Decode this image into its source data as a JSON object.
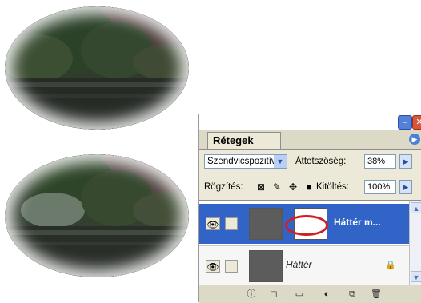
{
  "colors": {
    "accent_selected": "#3264c8",
    "panel_bg": "#ece9d8",
    "annotation_ring": "#d22020"
  },
  "images": {
    "top_photo": "park-trees-water-oval-vignette",
    "bottom_photo": "park-trees-water-oval-vignette-screen-blend"
  },
  "panel": {
    "tab_label": "Rétegek",
    "blend_mode": "Szendvicspozitív",
    "opacity_label": "Áttetszőség:",
    "opacity_value": "38%",
    "lock_label": "Rögzítés:",
    "fill_label": "Kitöltés:",
    "fill_value": "100%",
    "layers": [
      {
        "name": "Háttér m...",
        "selected": true
      },
      {
        "name": "Háttér",
        "selected": false,
        "locked": true
      }
    ],
    "icons": {
      "minimize": "minimize-icon",
      "close": "close-icon",
      "menu": "panel-menu-icon",
      "eye": "eye-icon",
      "lock": "lock-icon"
    }
  }
}
